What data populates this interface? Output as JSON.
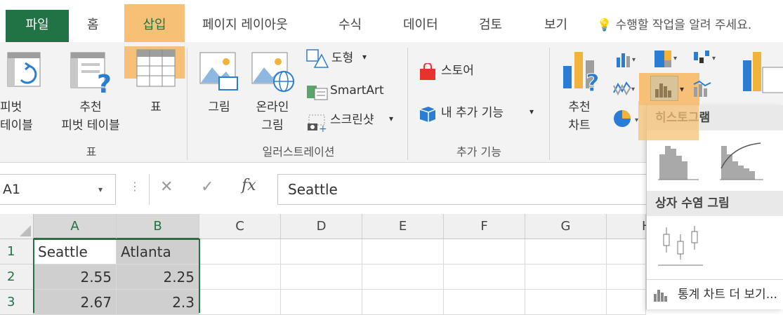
{
  "tabs": {
    "file": "파일",
    "home": "홈",
    "insert": "삽입",
    "page_layout": "페이지 레이아웃",
    "formulas": "수식",
    "data": "데이터",
    "review": "검토",
    "view": "보기",
    "tell_me": "수행할 작업을 알려 주세요."
  },
  "ribbon": {
    "pivot_table": [
      "피벗",
      "테이블"
    ],
    "recommended_pivot": [
      "추천",
      "피벗 테이블"
    ],
    "table": "표",
    "group_tables": "표",
    "pictures": "그림",
    "online_pictures": [
      "온라인",
      "그림"
    ],
    "shapes": "도형",
    "smartart": "SmartArt",
    "screenshot": "스크린샷",
    "group_illustrations": "일러스트레이션",
    "store": "스토어",
    "my_addins": "내 추가 기능",
    "group_addins": "추가 기능",
    "recommended_charts": [
      "추천",
      "차트"
    ]
  },
  "formula_bar": {
    "name_box": "A1",
    "fx": "fx",
    "value": "Seattle"
  },
  "grid": {
    "columns": [
      "A",
      "B",
      "C",
      "D",
      "E",
      "F",
      "G",
      "H"
    ],
    "rows": [
      {
        "num": "1",
        "a": "Seattle",
        "b": "Atlanta"
      },
      {
        "num": "2",
        "a": "2.55",
        "b": "2.25"
      },
      {
        "num": "3",
        "a": "2.67",
        "b": "2.3"
      }
    ]
  },
  "dropdown": {
    "histogram": "히스토그램",
    "box_whisker": "상자 수염 그림",
    "more": "통계 차트 더 보기..."
  },
  "colors": {
    "accent": "#217346",
    "highlight": "#f6c177"
  }
}
